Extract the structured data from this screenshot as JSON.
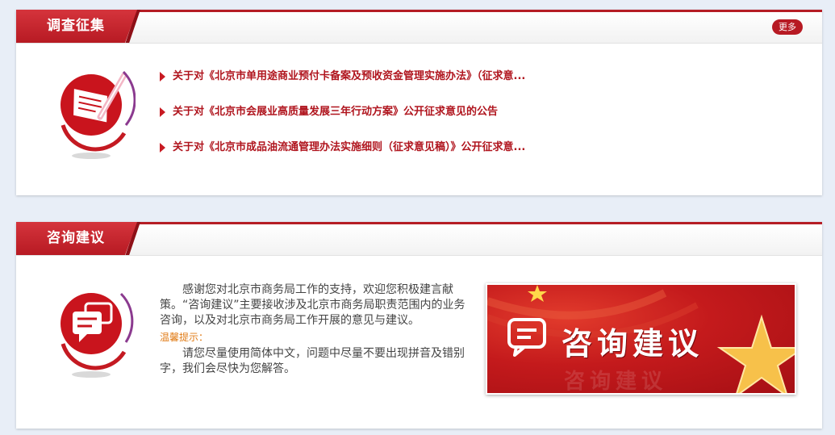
{
  "colors": {
    "brand": "#b71a23",
    "link": "#b0151e",
    "tip": "#e07b16",
    "background": "#e8eef7"
  },
  "survey": {
    "title": "调查征集",
    "more": "更多",
    "icon": "survey-pen-icon",
    "items": [
      "关于对《北京市单用途商业预付卡备案及预收资金管理实施办法》（征求意...",
      "关于对《北京市会展业高质量发展三年行动方案》公开征求意见的公告",
      "关于对《北京市成品油流通管理办法实施细则（征求意见稿）》公开征求意..."
    ]
  },
  "consult": {
    "title": "咨询建议",
    "icon": "chat-bubbles-icon",
    "intro": "感谢您对北京市商务局工作的支持，欢迎您积极建言献策。“咨询建议”主要接收涉及北京市商务局职责范围内的业务咨询，以及对北京市商务局工作开展的意见与建议。",
    "tip_label": "温馨提示：",
    "tip_text": "请您尽量使用简体中文，问题中尽量不要出现拼音及错别字，我们会尽快为您解答。",
    "banner_title": "咨询建议",
    "banner_icon": "chat-bubble-icon"
  }
}
